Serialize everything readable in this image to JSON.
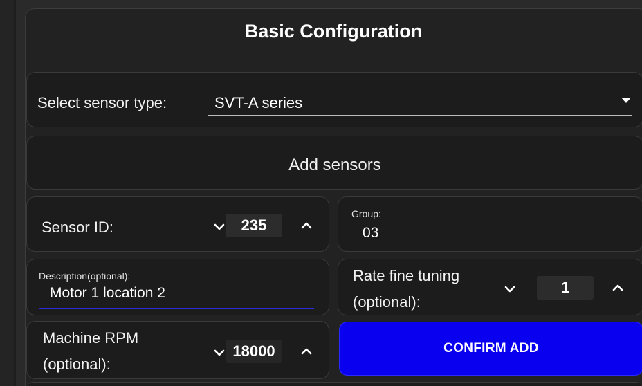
{
  "title": "Basic Configuration",
  "sensor_type": {
    "label": "Select sensor type:",
    "value": "SVT-A series"
  },
  "add_sensors": {
    "label": "Add sensors"
  },
  "sensor_id": {
    "label": "Sensor ID:",
    "value": "235"
  },
  "group": {
    "label": "Group:",
    "value": "03"
  },
  "description": {
    "label": "Description(optional):",
    "value": "Motor 1 location 2"
  },
  "rate_tuning": {
    "label_line1": "Rate fine tuning",
    "label_line2": "(optional):",
    "value": "1"
  },
  "machine_rpm": {
    "label_line1": "Machine RPM",
    "label_line2": "(optional):",
    "value": "18000"
  },
  "confirm_add": {
    "label": "CONFIRM ADD"
  },
  "colors": {
    "background": "#222222",
    "card": "#1c1c1c",
    "accent": "#0a00f0",
    "underline": "#2a2ad8"
  },
  "icons": [
    "chevron-down-icon",
    "chevron-up-icon",
    "dropdown-caret-icon"
  ]
}
